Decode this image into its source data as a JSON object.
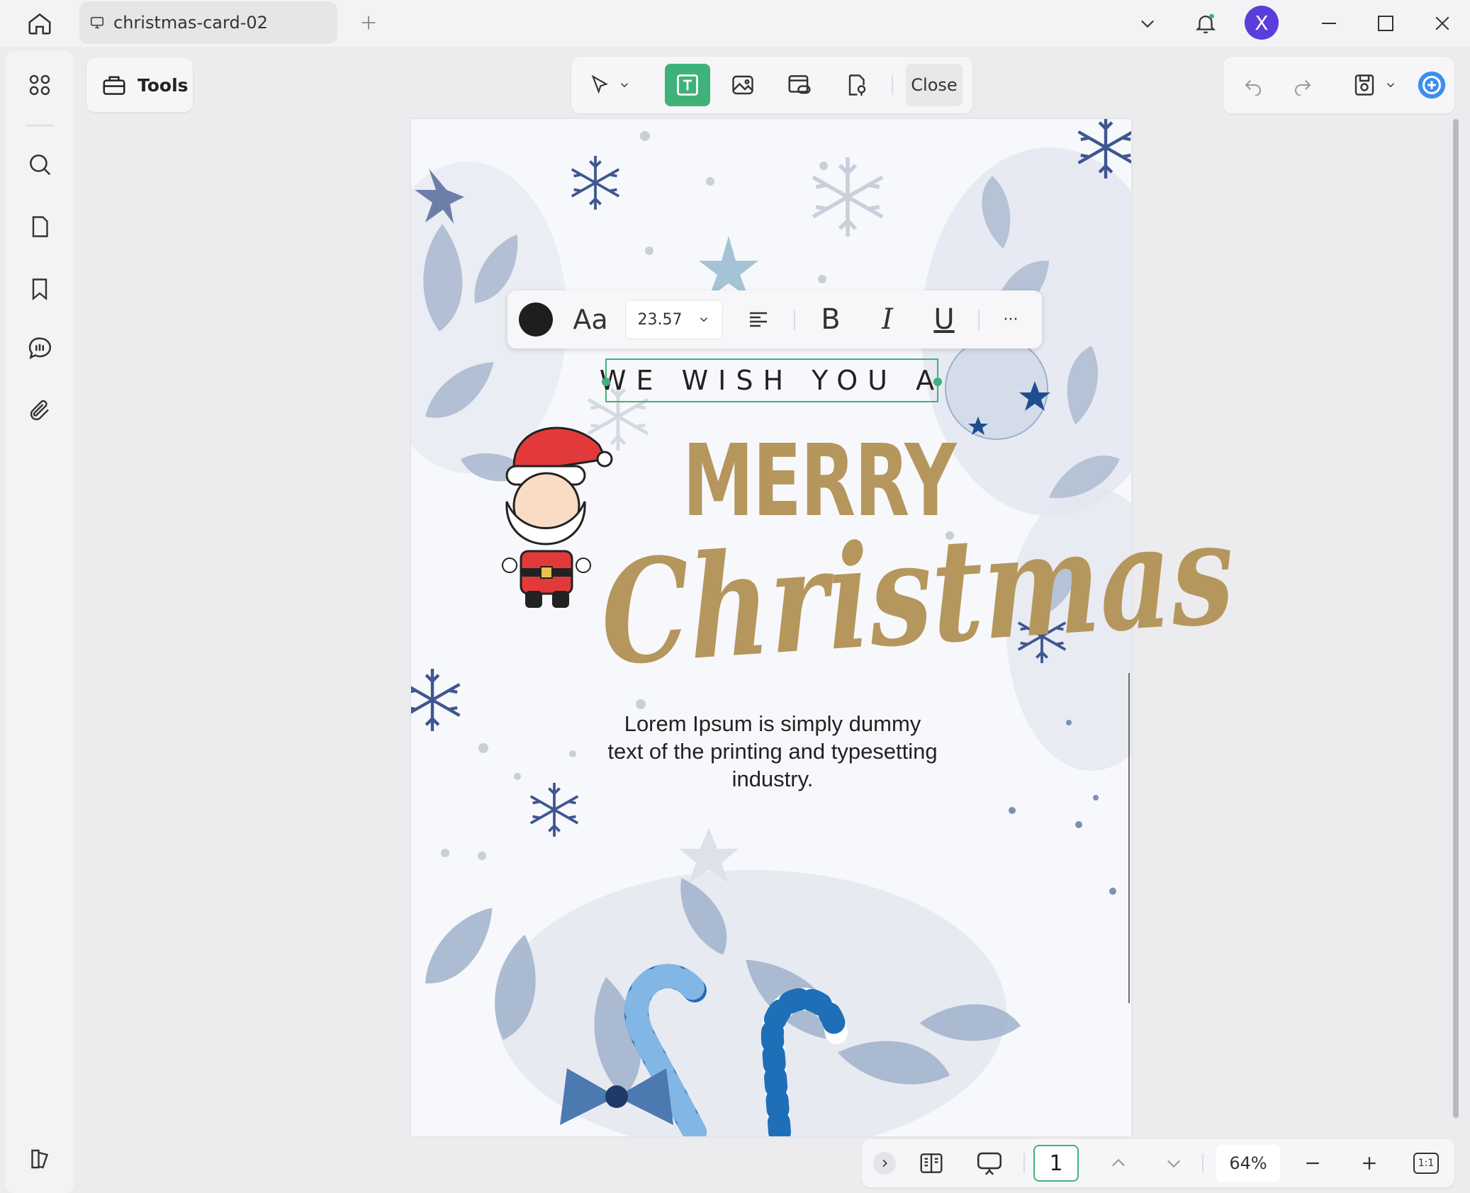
{
  "titlebar": {
    "tab_title": "christmas-card-02",
    "avatar_letter": "X"
  },
  "toolbar": {
    "tools_label": "Tools",
    "close_label": "Close"
  },
  "format_bar": {
    "font_size": "23.57",
    "font_label": "Aa",
    "bold_label": "B",
    "italic_label": "I",
    "underline_label": "U",
    "more_label": "···"
  },
  "card": {
    "selected_text": "WE WISH YOU A",
    "merry": "MERRY",
    "christmas": "Christmas",
    "body_line1": "Lorem Ipsum is simply dummy",
    "body_line2": "text of the printing and typesetting",
    "body_line3": "industry."
  },
  "bottom_bar": {
    "page_number": "1",
    "zoom": "64%",
    "actual_size_label": "1:1"
  },
  "colors": {
    "accent": "#3fb27a",
    "gold": "#b5965d",
    "avatar": "#5b3ddb"
  }
}
